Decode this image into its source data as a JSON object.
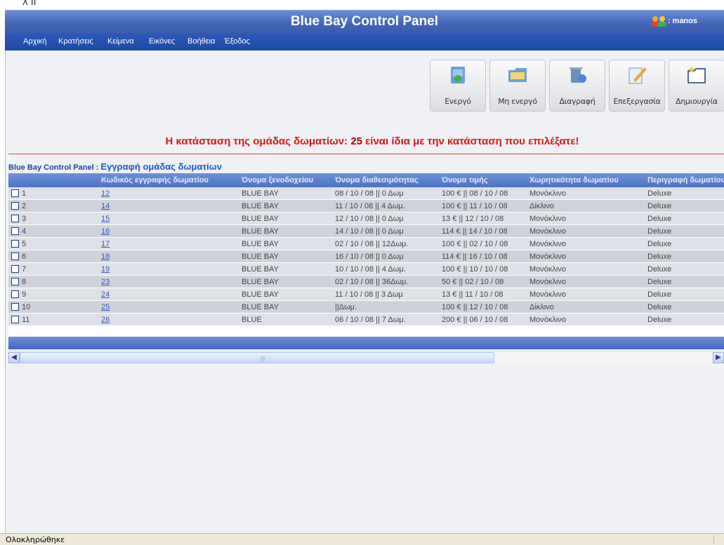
{
  "top_fragment": "λ ΙΙ",
  "app": {
    "title": "Blue Bay Control Panel",
    "user": ": manos"
  },
  "menu": [
    {
      "label": "Αρχική"
    },
    {
      "label": "Κρατήσεις"
    },
    {
      "label": "Κείμενα"
    },
    {
      "label": "Εικόνες"
    },
    {
      "label": "Βοήθεια"
    },
    {
      "label": "Έξοδος"
    }
  ],
  "toolbar": [
    {
      "label": "Ενεργό",
      "icon": "activate-icon"
    },
    {
      "label": "Μη ενεργό",
      "icon": "folder-icon"
    },
    {
      "label": "Διαγραφή",
      "icon": "trash-icon"
    },
    {
      "label": "Επεξεργασία",
      "icon": "edit-icon"
    },
    {
      "label": "Δημιουργία",
      "icon": "new-folder-icon"
    }
  ],
  "alert": {
    "before": "Η κατάσταση της ομάδας δωματίων: ",
    "number": "25",
    "after": " είναι ίδια με την κατάσταση που επιλέξατε!"
  },
  "breadcrumb": {
    "root": "Blue Bay Control Panel",
    "sep": " : ",
    "section": "Εγγραφή ομάδας δωματίων"
  },
  "table": {
    "columns": [
      "",
      "Κωδικός εγγραφής δωματίου",
      "Όνομα ξενοδοχείου",
      "Όνομα διαθεσιμότητας",
      "Όνομα τιμής",
      "Χωρητικότητα δωματίου",
      "Περιγραφή δωματίου"
    ],
    "rows": [
      {
        "n": "1",
        "code": "12",
        "hotel": "BLUE BAY",
        "avail": "08 / 10 / 08 || 0 Δωμ",
        "price": "100 € || 08 / 10 / 08",
        "capacity": "Μονόκλινο",
        "desc": "Deluxe"
      },
      {
        "n": "2",
        "code": "14",
        "hotel": "BLUE BAY",
        "avail": "11 / 10 / 08 || 4 Δωμ.",
        "price": "100 € || 11 / 10 / 08",
        "capacity": "Δίκλινο",
        "desc": "Deluxe"
      },
      {
        "n": "3",
        "code": "15",
        "hotel": "BLUE BAY",
        "avail": "12 / 10 / 08 || 0 Δωμ",
        "price": "13 € || 12 / 10 / 08",
        "capacity": "Μονόκλινο",
        "desc": "Deluxe"
      },
      {
        "n": "4",
        "code": "16",
        "hotel": "BLUE BAY",
        "avail": "14 / 10 / 08 || 0 Δωμ",
        "price": "114 € || 14 / 10 / 08",
        "capacity": "Μονόκλινο",
        "desc": "Deluxe"
      },
      {
        "n": "5",
        "code": "17",
        "hotel": "BLUE BAY",
        "avail": "02 / 10 / 08 || 12Δωμ.",
        "price": "100 € || 02 / 10 / 08",
        "capacity": "Μονόκλινο",
        "desc": "Deluxe"
      },
      {
        "n": "6",
        "code": "18",
        "hotel": "BLUE BAY",
        "avail": "16 / 10 / 08 || 0 Δωμ",
        "price": "114 € || 16 / 10 / 08",
        "capacity": "Μονόκλινο",
        "desc": "Deluxe"
      },
      {
        "n": "7",
        "code": "19",
        "hotel": "BLUE BAY",
        "avail": "10 / 10 / 08 || 4 Δωμ.",
        "price": "100 € || 10 / 10 / 08",
        "capacity": "Μονόκλινο",
        "desc": "Deluxe"
      },
      {
        "n": "8",
        "code": "23",
        "hotel": "BLUE BAY",
        "avail": "02 / 10 / 08 || 36Δωμ.",
        "price": "50 € || 02 / 10 / 08",
        "capacity": "Μονόκλινο",
        "desc": "Deluxe"
      },
      {
        "n": "9",
        "code": "24",
        "hotel": "BLUE BAY",
        "avail": "11 / 10 / 08 || 3 Δωμ",
        "price": "13 € || 11 / 10 / 08",
        "capacity": "Μονόκλινο",
        "desc": "Deluxe"
      },
      {
        "n": "10",
        "code": "25",
        "hotel": "BLUE BAY",
        "avail": "||Δωμ.",
        "price": "100 € || 12 / 10 / 08",
        "capacity": "Δίκλινο",
        "desc": "Deluxe"
      },
      {
        "n": "11",
        "code": "26",
        "hotel": "BLUE",
        "avail": "06 / 10 / 08 || 7 Δωμ.",
        "price": "200 € || 06 / 10 / 08",
        "capacity": "Μονόκλινο",
        "desc": "Deluxe"
      }
    ]
  },
  "status": "Ολοκληρώθηκε",
  "colors": {
    "title_bar": "#4366b8",
    "menu_bar": "#1f4aa6",
    "alert": "#e01414",
    "link": "#3a58b8",
    "header": "#5a7ecb"
  }
}
